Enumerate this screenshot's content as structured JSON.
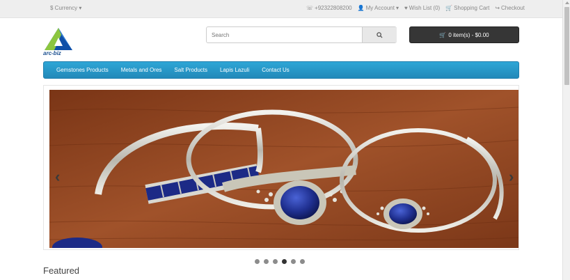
{
  "topbar": {
    "currency": "$ Currency",
    "phone": "+92322808200",
    "my_account": "My Account",
    "wish_list": "Wish List (0)",
    "shopping_cart": "Shopping Cart",
    "checkout": "Checkout"
  },
  "header": {
    "logo_text": "arc-biz",
    "search_placeholder": "Search",
    "cart_label": "0 item(s) - $0.00"
  },
  "nav": {
    "items": [
      "Gemstones Products",
      "Metals and Ores",
      "Salt Products",
      "Lapis Lazuli",
      "Contact Us"
    ]
  },
  "slideshow": {
    "slide_count": 6,
    "active_index": 3
  },
  "section": {
    "featured_title": "Featured"
  },
  "colors": {
    "nav_blue": "#2a9fd0",
    "cart_dark": "#363636",
    "lapis_blue": "#1f2f8f",
    "wood": "#8b3f1e"
  }
}
